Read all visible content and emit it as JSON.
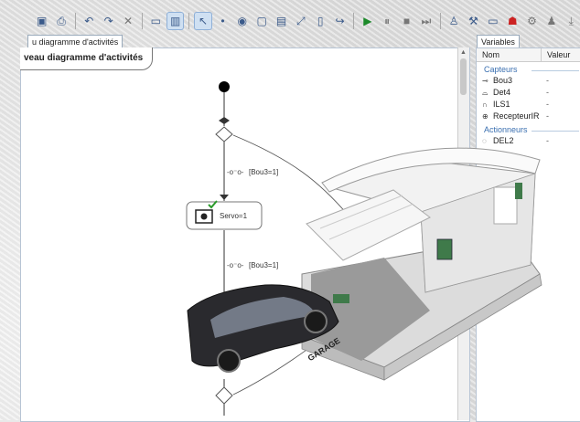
{
  "toolbar": {
    "icons": [
      "save-icon",
      "print-icon",
      "undo-icon",
      "redo-icon",
      "delete-icon",
      "view-icon",
      "view-active-icon",
      "pointer-icon",
      "dot-icon",
      "target-icon",
      "rect-icon",
      "image-icon",
      "expand-icon",
      "page-icon",
      "arrow-icon",
      "play-icon",
      "pause-icon",
      "stop-icon",
      "step-icon",
      "robot-icon",
      "tools-icon",
      "card-icon",
      "ghost-icon",
      "gear-icon",
      "person-icon",
      "download-icon"
    ]
  },
  "tabs": {
    "diagram": "u diagramme d'activités",
    "variables": "Variables"
  },
  "editor": {
    "title": "veau diagramme d'activités",
    "transition1": "[Bou3=1]",
    "action": "Servo=1",
    "transition2": "[Bou3=1]"
  },
  "variables": {
    "col_name": "Nom",
    "col_value": "Valeur",
    "groups": [
      {
        "label": "Capteurs",
        "items": [
          {
            "name": "Bou3",
            "value": "-"
          },
          {
            "name": "Det4",
            "value": "-"
          },
          {
            "name": "ILS1",
            "value": "-"
          },
          {
            "name": "RecepteurIR",
            "value": "-"
          }
        ]
      },
      {
        "label": "Actionneurs",
        "items": [
          {
            "name": "DEL2",
            "value": "-"
          }
        ]
      }
    ]
  },
  "overlay": {
    "garage_label": "GARAGE"
  },
  "colors": {
    "accent": "#3a6fb0",
    "play": "#1c8a2a"
  }
}
